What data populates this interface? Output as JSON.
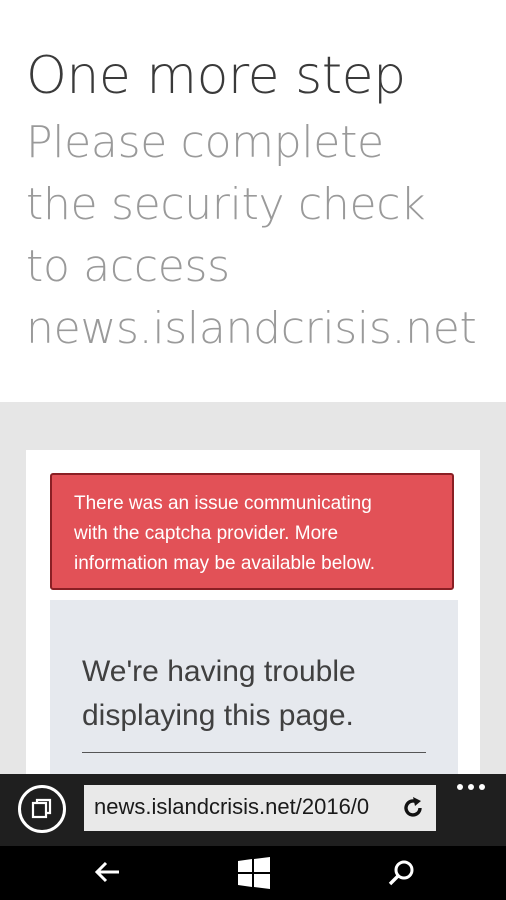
{
  "header": {
    "title": "One more step",
    "subtitle_lines": [
      "Please complete",
      "the security check",
      "to access",
      "news.islandcrisis.net"
    ]
  },
  "alert": {
    "lines": [
      "There was an issue communicating",
      "with the captcha provider. More",
      "information may be available below."
    ],
    "color": "#e25157"
  },
  "trouble": {
    "lines": [
      "We're having trouble",
      "displaying this page."
    ]
  },
  "browser": {
    "url": "news.islandcrisis.net/2016/0",
    "icons": [
      "tabs-icon",
      "refresh-icon",
      "more-icon"
    ]
  },
  "nav": {
    "icons": [
      "back-arrow-icon",
      "windows-start-icon",
      "search-icon"
    ]
  }
}
